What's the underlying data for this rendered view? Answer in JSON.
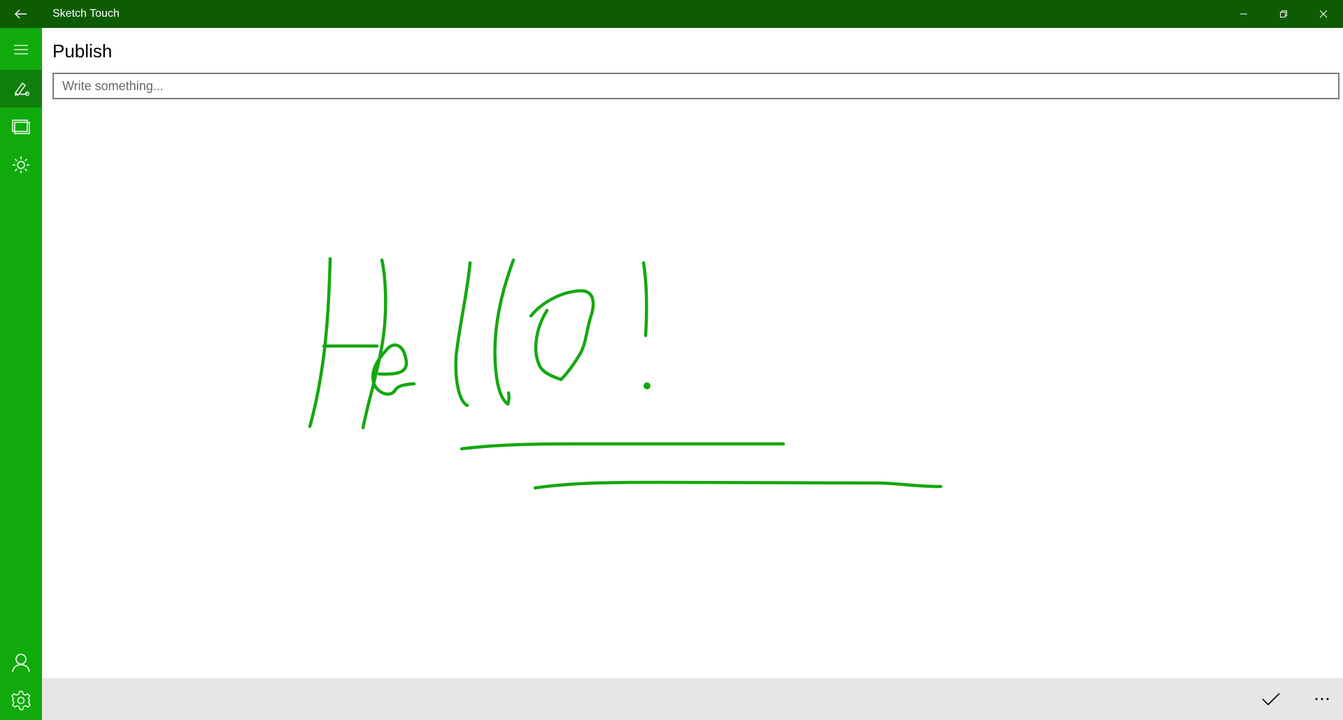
{
  "window": {
    "title": "Sketch Touch",
    "back_icon": "back-arrow-icon",
    "controls": [
      "minimize-icon",
      "restore-icon",
      "close-icon"
    ]
  },
  "sidebar": {
    "items": [
      {
        "name": "hamburger-menu",
        "icon": "hamburger-icon",
        "active": false
      },
      {
        "name": "sketch",
        "icon": "pen-icon",
        "active": true
      },
      {
        "name": "gallery",
        "icon": "gallery-icon",
        "active": false
      },
      {
        "name": "brightness",
        "icon": "sun-icon",
        "active": false
      },
      {
        "name": "account",
        "icon": "person-icon",
        "active": false
      },
      {
        "name": "settings",
        "icon": "gear-icon",
        "active": false
      }
    ]
  },
  "main": {
    "title": "Publish",
    "input": {
      "value": "",
      "placeholder": "Write something..."
    },
    "sketch": {
      "content": "handwritten Hello! with two underlines",
      "stroke_color": "#14a80f"
    }
  },
  "bottombar": {
    "buttons": [
      {
        "name": "confirm",
        "icon": "checkmark-icon"
      },
      {
        "name": "more",
        "icon": "more-icon"
      }
    ]
  },
  "colors": {
    "titlebar": "#0e5c02",
    "sidebar": "#10aa0d",
    "sidebar_active": "#0e7f0a",
    "bottombar": "#e6e6e6",
    "ink": "#14a80f"
  }
}
